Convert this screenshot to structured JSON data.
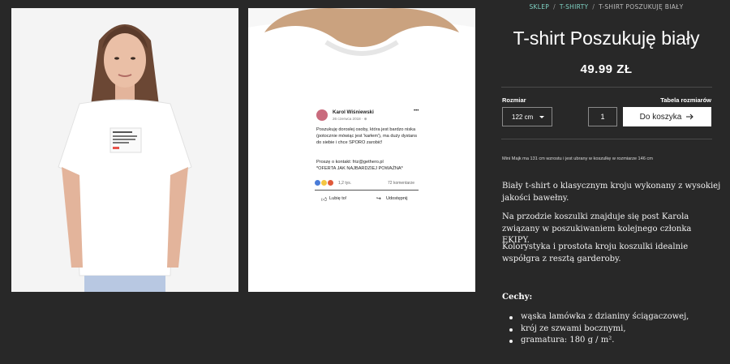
{
  "breadcrumb": {
    "home": "SKLEP",
    "category": "T-SHIRTY",
    "current": "T-SHIRT POSZUKUJĘ BIAŁY"
  },
  "product": {
    "title": "T-shirt Poszukuję biały",
    "price": "49.99 ZŁ"
  },
  "options": {
    "size_label": "Rozmiar",
    "size_table_link": "Tabela rozmiarów",
    "size_selected": "122 cm",
    "quantity": "1",
    "add_to_cart": "Do koszyka"
  },
  "size_note": "Mini Majk ma 131 cm wzrostu i jest ubrany w koszulkę w rozmiarze 146 cm",
  "description": [
    "Biały t-shirt o klasycznym kroju wykonany z wysokiej jakości bawełny.",
    "Na przodzie koszulki znajduje się post Karola związany w poszukiwaniem kolejnego członka EKIPY.",
    "Kolorystyka i prostota kroju koszulki idealnie współgra z resztą garderoby."
  ],
  "features_title": "Cechy:",
  "features": [
    "wąska lamówka z dzianiny ściągaczowej,",
    "krój ze szwami bocznymi,",
    "gramatura: 180 g / m²."
  ],
  "print": {
    "author": "Karol Wiśniewski",
    "date": "26 czerwca 2018 · ⊕",
    "body": "Poszukuję dorosłej osoby, która jest bardzo niska (potocznie mówiąc jest 'karłem'), ma duży dystans do siebie i chce SPORO zarobić!",
    "contact": "Proszę o kontakt: friz@gethero.pl",
    "tagline": "*OFERTA JAK NAJBARDZIEJ POWAŻNA*",
    "reactions": "1,2 tys.",
    "comments": "72 komentarze",
    "like": "Lubię to!",
    "share": "Udostępnij"
  },
  "colors": {
    "background": "#282828",
    "breadcrumb_link": "#7fd3c4",
    "button": "#ffffff"
  }
}
